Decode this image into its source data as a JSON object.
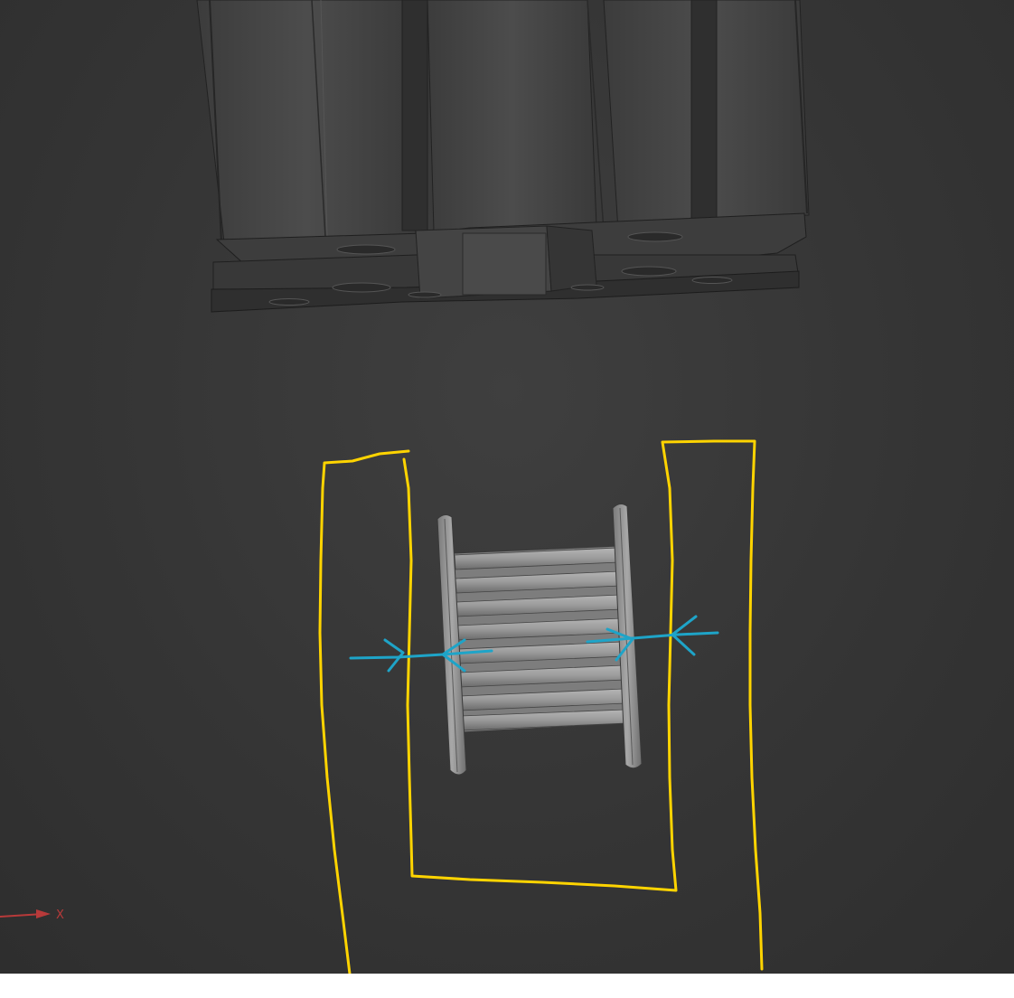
{
  "viewport": {
    "background": "#353535"
  },
  "axis_triad": {
    "x_label": "X",
    "x_color": "#b83a3a"
  },
  "annotations": {
    "outline_color": "#ffd400",
    "arrow_color": "#1ea4c8"
  },
  "model": {
    "extrusion_color": "#4a4a4a",
    "pulley_color": "#8e8e8e"
  }
}
